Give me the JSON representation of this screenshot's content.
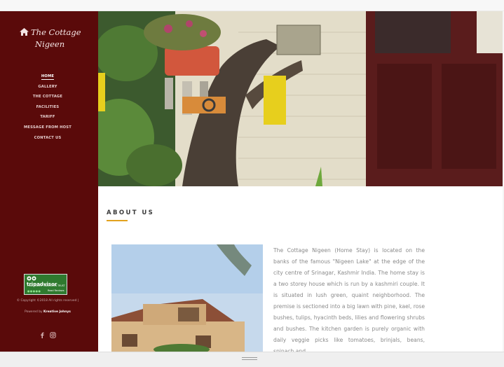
{
  "brand": {
    "line1": "The Cottage",
    "line2": "Nigeen"
  },
  "nav": [
    {
      "label": "HOME",
      "active": true
    },
    {
      "label": "GALLERY",
      "active": false
    },
    {
      "label": "THE COTTAGE",
      "active": false
    },
    {
      "label": "FACILITIES",
      "active": false
    },
    {
      "label": "TARIFF",
      "active": false
    },
    {
      "label": "MESSAGE FROM HOST",
      "active": false
    },
    {
      "label": "CONTACT US",
      "active": false
    }
  ],
  "tripadvisor": {
    "logo_text": "tripadvisor",
    "tagline": "FIND PLACES TRAVELLERS TRUST",
    "reviews": "Read Reviews",
    "stars": "●●●●●"
  },
  "footer": {
    "copyright": "© Copyright ©2018 All rights reserved |",
    "powered_prefix": "Powered by",
    "powered_name": "Kreative Johnys"
  },
  "about": {
    "title": "ABOUT US",
    "text": "The Cottage Nigeen (Home Stay) is located on the banks of the famous \"Nigeen Lake\" at the edge of the city centre of Srinagar, Kashmir India. The home stay is a two storey house which is run by a kashmiri couple. It is situated in lush green, quaint neighborhood. The premise is sectioned into a big lawn with pine, kael, rose bushes, tulips, hyacinth beds, lilies and flowering shrubs and bushes. The kitchen garden is purely organic with daily veggie picks like tomatoes, brinjals, beans, spinach and"
  },
  "icons": {
    "home": "home-icon",
    "facebook": "facebook-icon",
    "instagram": "instagram-icon"
  },
  "colors": {
    "sidebar": "#5a0a0a",
    "accent": "#e2a21e",
    "tripadvisor": "#2f7a2f"
  }
}
